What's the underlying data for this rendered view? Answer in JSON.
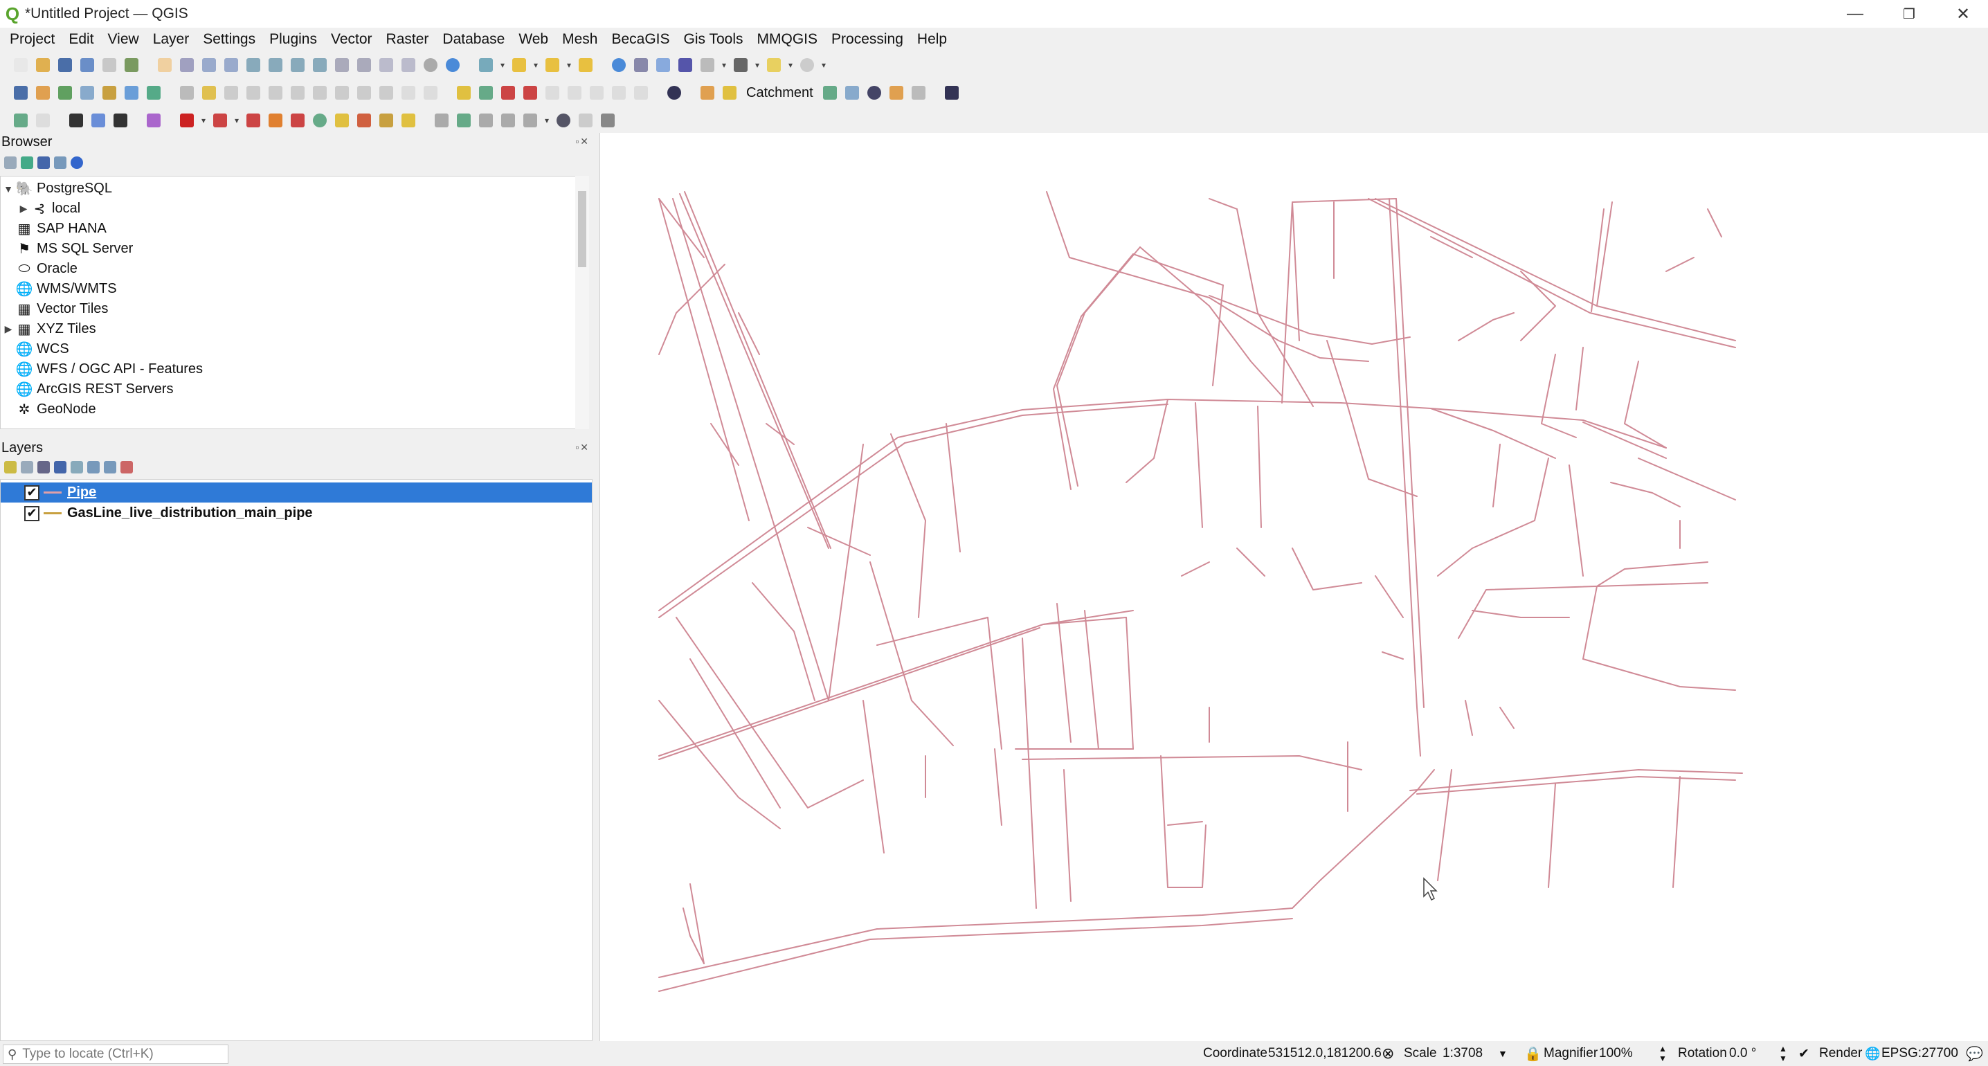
{
  "window": {
    "title": "*Untitled Project — QGIS",
    "logo_glyph": "Q",
    "minimize": "—",
    "restore": "❐",
    "close": "✕"
  },
  "menu": [
    "Project",
    "Edit",
    "View",
    "Layer",
    "Settings",
    "Plugins",
    "Vector",
    "Raster",
    "Database",
    "Web",
    "Mesh",
    "BecaGIS",
    "Gis Tools",
    "MMQGIS",
    "Processing",
    "Help"
  ],
  "toolbar": {
    "catchment_label": "Catchment"
  },
  "browser": {
    "title": "Browser",
    "items": [
      {
        "label": "PostgreSQL",
        "arrow": "▼",
        "icon": "postgresql-icon",
        "glyph": "🐘",
        "indent": 0
      },
      {
        "label": "local",
        "arrow": "▶",
        "icon": "connection-icon",
        "glyph": "⊰",
        "indent": 1
      },
      {
        "label": "SAP HANA",
        "arrow": "",
        "icon": "sap-hana-icon",
        "glyph": "▦",
        "indent": 0
      },
      {
        "label": "MS SQL Server",
        "arrow": "",
        "icon": "mssql-icon",
        "glyph": "⚑",
        "indent": 0
      },
      {
        "label": "Oracle",
        "arrow": "",
        "icon": "oracle-icon",
        "glyph": "⬭",
        "indent": 0
      },
      {
        "label": "WMS/WMTS",
        "arrow": "",
        "icon": "wms-icon",
        "glyph": "🌐",
        "indent": 0
      },
      {
        "label": "Vector Tiles",
        "arrow": "",
        "icon": "vector-tiles-icon",
        "glyph": "▦",
        "indent": 0
      },
      {
        "label": "XYZ Tiles",
        "arrow": "▶",
        "icon": "xyz-tiles-icon",
        "glyph": "▦",
        "indent": 0
      },
      {
        "label": "WCS",
        "arrow": "",
        "icon": "wcs-icon",
        "glyph": "🌐",
        "indent": 0
      },
      {
        "label": "WFS / OGC API - Features",
        "arrow": "",
        "icon": "wfs-icon",
        "glyph": "🌐",
        "indent": 0
      },
      {
        "label": "ArcGIS REST Servers",
        "arrow": "",
        "icon": "arcgis-icon",
        "glyph": "🌐",
        "indent": 0
      },
      {
        "label": "GeoNode",
        "arrow": "",
        "icon": "geonode-icon",
        "glyph": "✲",
        "indent": 0
      }
    ]
  },
  "layers": {
    "title": "Layers",
    "items": [
      {
        "label": "Pipe",
        "checked": "✔",
        "selected": true,
        "color": "#e0a0a8"
      },
      {
        "label": "GasLine_live_distribution_main_pipe",
        "checked": "✔",
        "selected": false,
        "color": "#c8a040"
      }
    ]
  },
  "map": {
    "line_color": "#d08a96"
  },
  "status": {
    "locator_placeholder": "Type to locate (Ctrl+K)",
    "coordinate_label": "Coordinate",
    "coordinate_value": "531512.0,181200.6",
    "scale_label": "Scale",
    "scale_value": "1:3708",
    "magnifier_label": "Magnifier",
    "magnifier_value": "100%",
    "rotation_label": "Rotation",
    "rotation_value": "0.0 °",
    "render_label": "Render",
    "render_checked": "✔",
    "crs": "EPSG:27700"
  }
}
